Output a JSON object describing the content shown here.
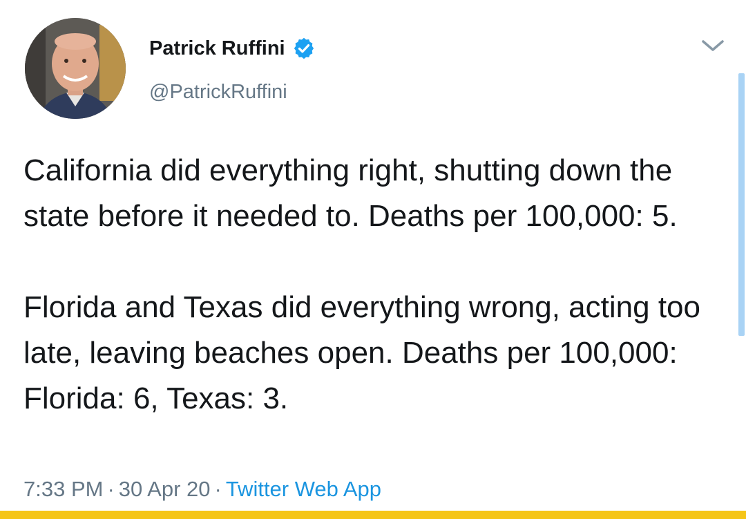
{
  "tweet": {
    "author": {
      "display_name": "Patrick Ruffini",
      "handle": "@PatrickRuffini",
      "verified": true
    },
    "text_paragraphs": [
      "California did everything right, shutting down the state before it needed to. Deaths per 100,000: 5.",
      "Florida and Texas did everything wrong, acting too late, leaving beaches open. Deaths per 100,000: Florida: 6, Texas: 3."
    ],
    "time": "7:33 PM",
    "date": "30 Apr 20",
    "separator": "·",
    "source": "Twitter Web App"
  },
  "icons": {
    "verified": "verified-badge-icon",
    "menu": "chevron-down-icon"
  },
  "colors": {
    "text": "#14171a",
    "secondary": "#657786",
    "link": "#1b95e0",
    "verified": "#1da1f2",
    "bottom_bar": "#f5c518",
    "scrollbar": "#a9d3f5"
  }
}
